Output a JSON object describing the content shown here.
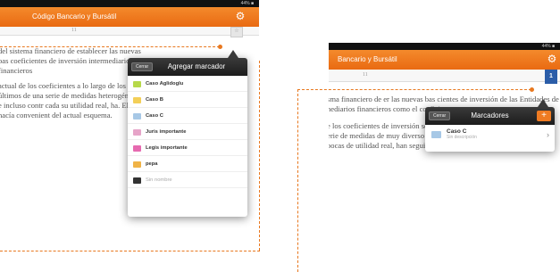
{
  "left_screen": {
    "status_text": "44% ■",
    "app_title": "Código Bancario y Bursátil",
    "page_number": "11",
    "paragraphs": [
      "del sistema financiero de establecer las nuevas bas coeficientes de inversión intermediarios financieros",
      "actual de los coeficientes a lo largo de los últimos de una serie de medidas heterogéneas e incluso contr cada su utilidad real, ha. Ello hacía convenient del actual esquema."
    ],
    "popup": {
      "close_label": "Cerrar",
      "title": "Agregar marcador",
      "items": [
        {
          "label": "Caso Aglidoglu",
          "color": "#b7d94a"
        },
        {
          "label": "Caso B",
          "color": "#f3cf58"
        },
        {
          "label": "Caso C",
          "color": "#a7c8e6"
        },
        {
          "label": "Juris importante",
          "color": "#e6a4c8"
        },
        {
          "label": "Legis importante",
          "color": "#e66ab0"
        },
        {
          "label": "pepa",
          "color": "#f0b347"
        },
        {
          "label": "Sin nombre",
          "color": "#333333"
        }
      ]
    }
  },
  "right_screen": {
    "status_text": "44% ■",
    "app_title": "Bancario y Bursátil",
    "page_number": "11",
    "bookmark_badge": "1",
    "paragraphs": [
      "sma financiero de er las nuevas bas cientes de inversión de las Entidades de nediarios financieros como el coeficiente",
      "e los coeficientes de inversión se había largo de los últimos años mediante erie de medidas de muy diverso rango, as e incluso contradictorias; no pocas de utilidad real, han seguido vigentes por"
    ],
    "popup": {
      "close_label": "Cerrar",
      "title": "Marcadores",
      "add_label": "+",
      "items": [
        {
          "name": "Caso C",
          "description": "Sin descripción",
          "color": "#a7c8e6"
        }
      ]
    }
  },
  "colors": {
    "accent": "#e8781f",
    "bar": "#ef7b22"
  }
}
